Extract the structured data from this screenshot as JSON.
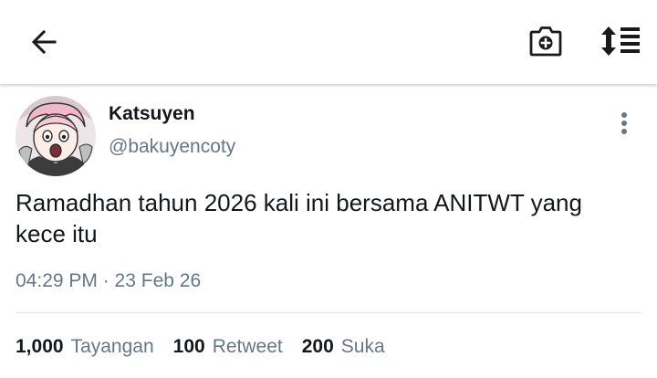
{
  "header": {
    "back_icon": "arrow-left-icon",
    "camera_icon": "camera-plus-icon",
    "sort_icon": "sort-list-icon"
  },
  "tweet": {
    "display_name": "Katsuyen",
    "handle": "@bakuyencoty",
    "text": "Ramadhan tahun 2026 kali ini bersama ANITWT yang kece itu",
    "timestamp": "04:29 PM · 23 Feb 26",
    "more_icon": "more-vertical-icon"
  },
  "stats": {
    "views_count": "1,000",
    "views_label": "Tayangan",
    "retweets_count": "100",
    "retweets_label": "Retweet",
    "likes_count": "200",
    "likes_label": "Suka"
  },
  "colors": {
    "text_primary": "#14171a",
    "text_secondary": "#657786",
    "divider": "#e1e8ed",
    "background": "#ffffff"
  }
}
